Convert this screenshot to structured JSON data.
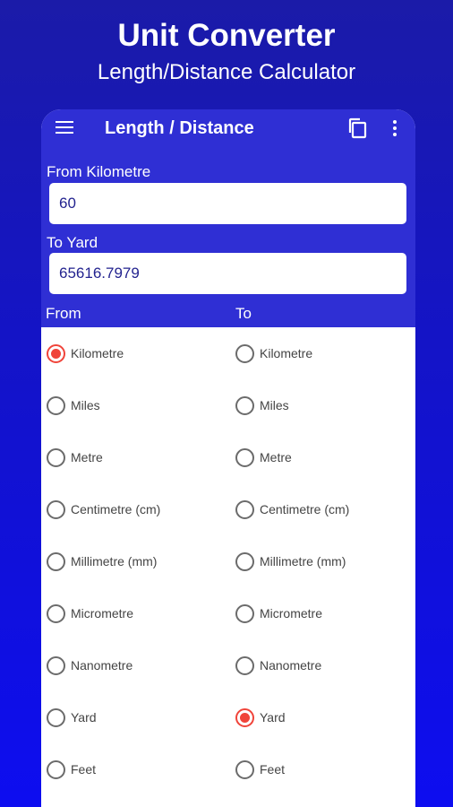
{
  "promo": {
    "title": "Unit Converter",
    "subtitle": "Length/Distance Calculator"
  },
  "toolbar": {
    "title": "Length / Distance",
    "menu_icon": "hamburger-menu-icon",
    "copy_icon": "copy-icon",
    "more_icon": "more-vertical-icon"
  },
  "from_field": {
    "label": "From Kilometre",
    "value": "60"
  },
  "to_field": {
    "label": "To Yard",
    "value": "65616.7979"
  },
  "columns": {
    "from": "From",
    "to": "To"
  },
  "units": [
    "Kilometre",
    "Miles",
    "Metre",
    "Centimetre (cm)",
    "Millimetre (mm)",
    "Micrometre",
    "Nanometre",
    "Yard",
    "Feet"
  ],
  "selected": {
    "from": "Kilometre",
    "to": "Yard"
  },
  "colors": {
    "header": "#2f2fd4",
    "radio_selected": "#f0443a",
    "field_text": "#23238f"
  }
}
